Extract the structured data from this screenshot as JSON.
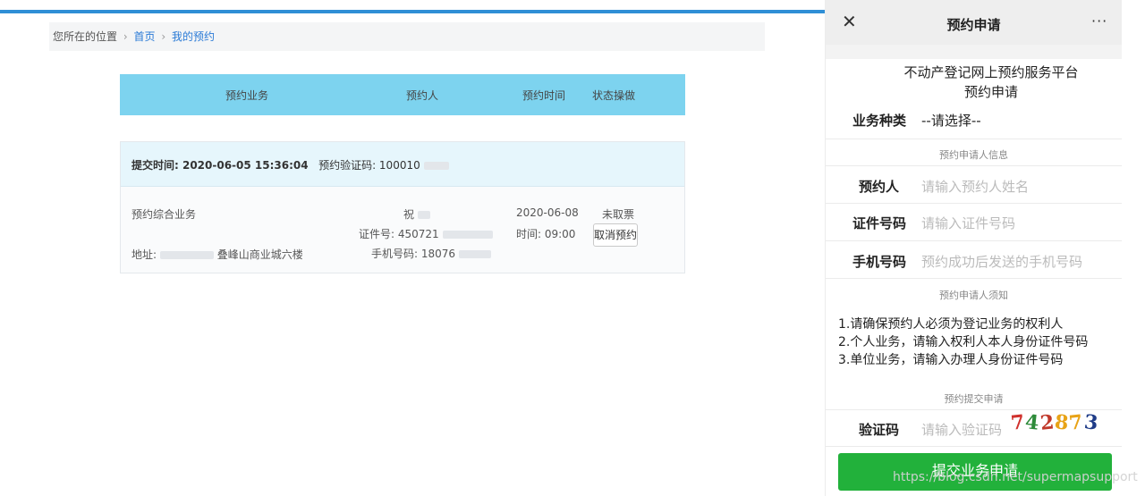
{
  "breadcrumb": {
    "prefix": "您所在的位置",
    "sep1": "›",
    "home": "首页",
    "sep2": "›",
    "current": "我的预约"
  },
  "table": {
    "headers": [
      "预约业务",
      "预约人",
      "预约时间",
      "状态操做"
    ]
  },
  "booking": {
    "submit_time_label": "提交时间: 2020-06-05 15:36:04",
    "code_label": "预约验证码: 100010",
    "service": "预约综合业务",
    "address_label": "地址:",
    "address_tail": "叠峰山商业城六楼",
    "person_name": "祝",
    "id_label": "证件号: 450721",
    "phone_label": "手机号码: 18076",
    "date": "2020-06-08",
    "time": "时间: 09:00",
    "status": "未取票",
    "cancel_label": "取消预约"
  },
  "phone": {
    "close_glyph": "✕",
    "nav_title": "预约申请",
    "more_glyph": "···",
    "title_line1": "不动产登记网上预约服务平台",
    "title_line2": "预约申请",
    "category_label": "业务种类",
    "category_value": "--请选择--",
    "section_info": "预约申请人信息",
    "name_label": "预约人",
    "name_placeholder": "请输入预约人姓名",
    "id_label": "证件号码",
    "id_placeholder": "请输入证件号码",
    "mobile_label": "手机号码",
    "mobile_placeholder": "预约成功后发送的手机号码",
    "section_notice": "预约申请人须知",
    "notice": [
      "1.请确保预约人必须为登记业务的权利人",
      "2.个人业务，请输入权利人本人身份证件号码",
      "3.单位业务，请输入办理人身份证件号码"
    ],
    "section_submit": "预约提交申请",
    "captcha_label": "验证码",
    "captcha_placeholder": "请输入验证码",
    "captcha_digits": [
      {
        "d": "7",
        "color": "#d0312d"
      },
      {
        "d": "4",
        "color": "#2e8b3a"
      },
      {
        "d": "2",
        "color": "#c0392b"
      },
      {
        "d": "8",
        "color": "#e8a317"
      },
      {
        "d": "7",
        "color": "#e8a317"
      },
      {
        "d": "3",
        "color": "#1f3c88"
      }
    ],
    "submit_label": "提交业务申请"
  },
  "watermark": "https://blog.csdn.net/supermapsupport",
  "colors": {
    "accent_blue": "#2f8fd6",
    "header_cyan": "#7dd3ef",
    "submit_green": "#22b13b"
  }
}
